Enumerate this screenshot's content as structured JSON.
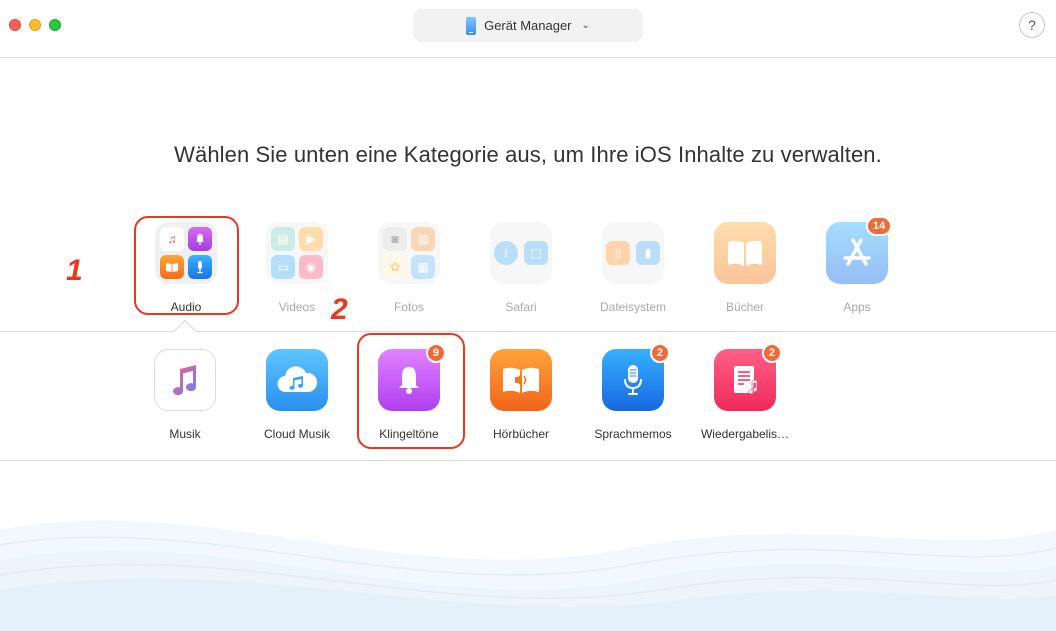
{
  "window": {
    "device_selector_label": "Gerät Manager",
    "help_label": "?"
  },
  "headline": "Wählen Sie unten eine Kategorie aus, um Ihre iOS Inhalte zu verwalten.",
  "categories": [
    {
      "label": "Audio",
      "active": true
    },
    {
      "label": "Videos"
    },
    {
      "label": "Fotos"
    },
    {
      "label": "Safari"
    },
    {
      "label": "Dateisystem"
    },
    {
      "label": "Bücher"
    },
    {
      "label": "Apps",
      "badge": "14"
    }
  ],
  "annotations": {
    "step1": "1",
    "step2": "2"
  },
  "audio_items": [
    {
      "label": "Musik"
    },
    {
      "label": "Cloud Musik"
    },
    {
      "label": "Klingeltöne",
      "badge": "9"
    },
    {
      "label": "Hörbücher"
    },
    {
      "label": "Sprachmemos",
      "badge": "2"
    },
    {
      "label": "Wiedergabelis…",
      "badge": "2"
    }
  ],
  "colors": {
    "accent_red": "#e8391f",
    "badge_orange": "#f06a35"
  }
}
